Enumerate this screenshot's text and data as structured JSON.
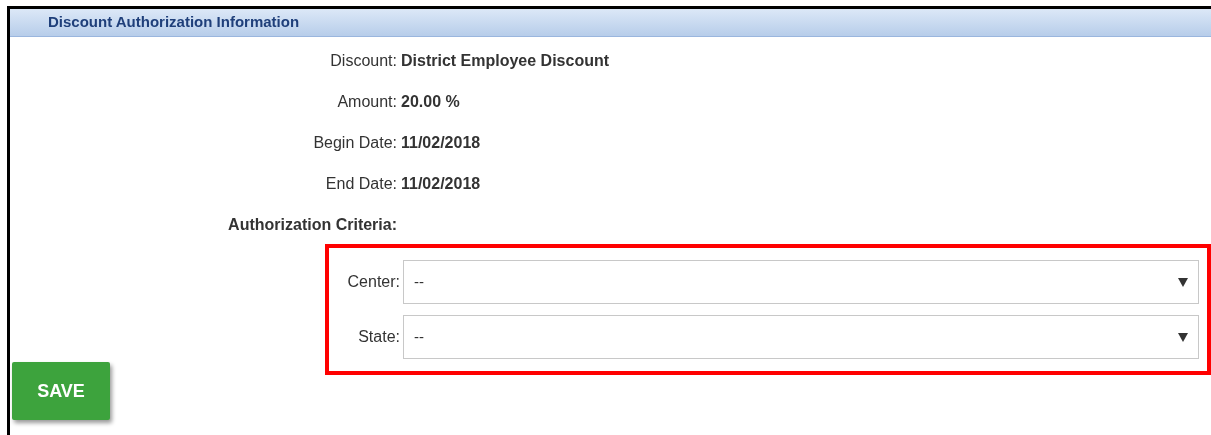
{
  "section": {
    "title": "Discount Authorization Information"
  },
  "details": [
    {
      "label": "Discount:",
      "value": "District Employee Discount"
    },
    {
      "label": "Amount:",
      "value": "20.00 %"
    },
    {
      "label": "Begin Date:",
      "value": "11/02/2018"
    },
    {
      "label": "End Date:",
      "value": "11/02/2018"
    }
  ],
  "criteria": {
    "heading": "Authorization Criteria:",
    "fields": [
      {
        "label": "Center:",
        "value": "--"
      },
      {
        "label": "State:",
        "value": "--"
      }
    ]
  },
  "save_button": "SAVE"
}
